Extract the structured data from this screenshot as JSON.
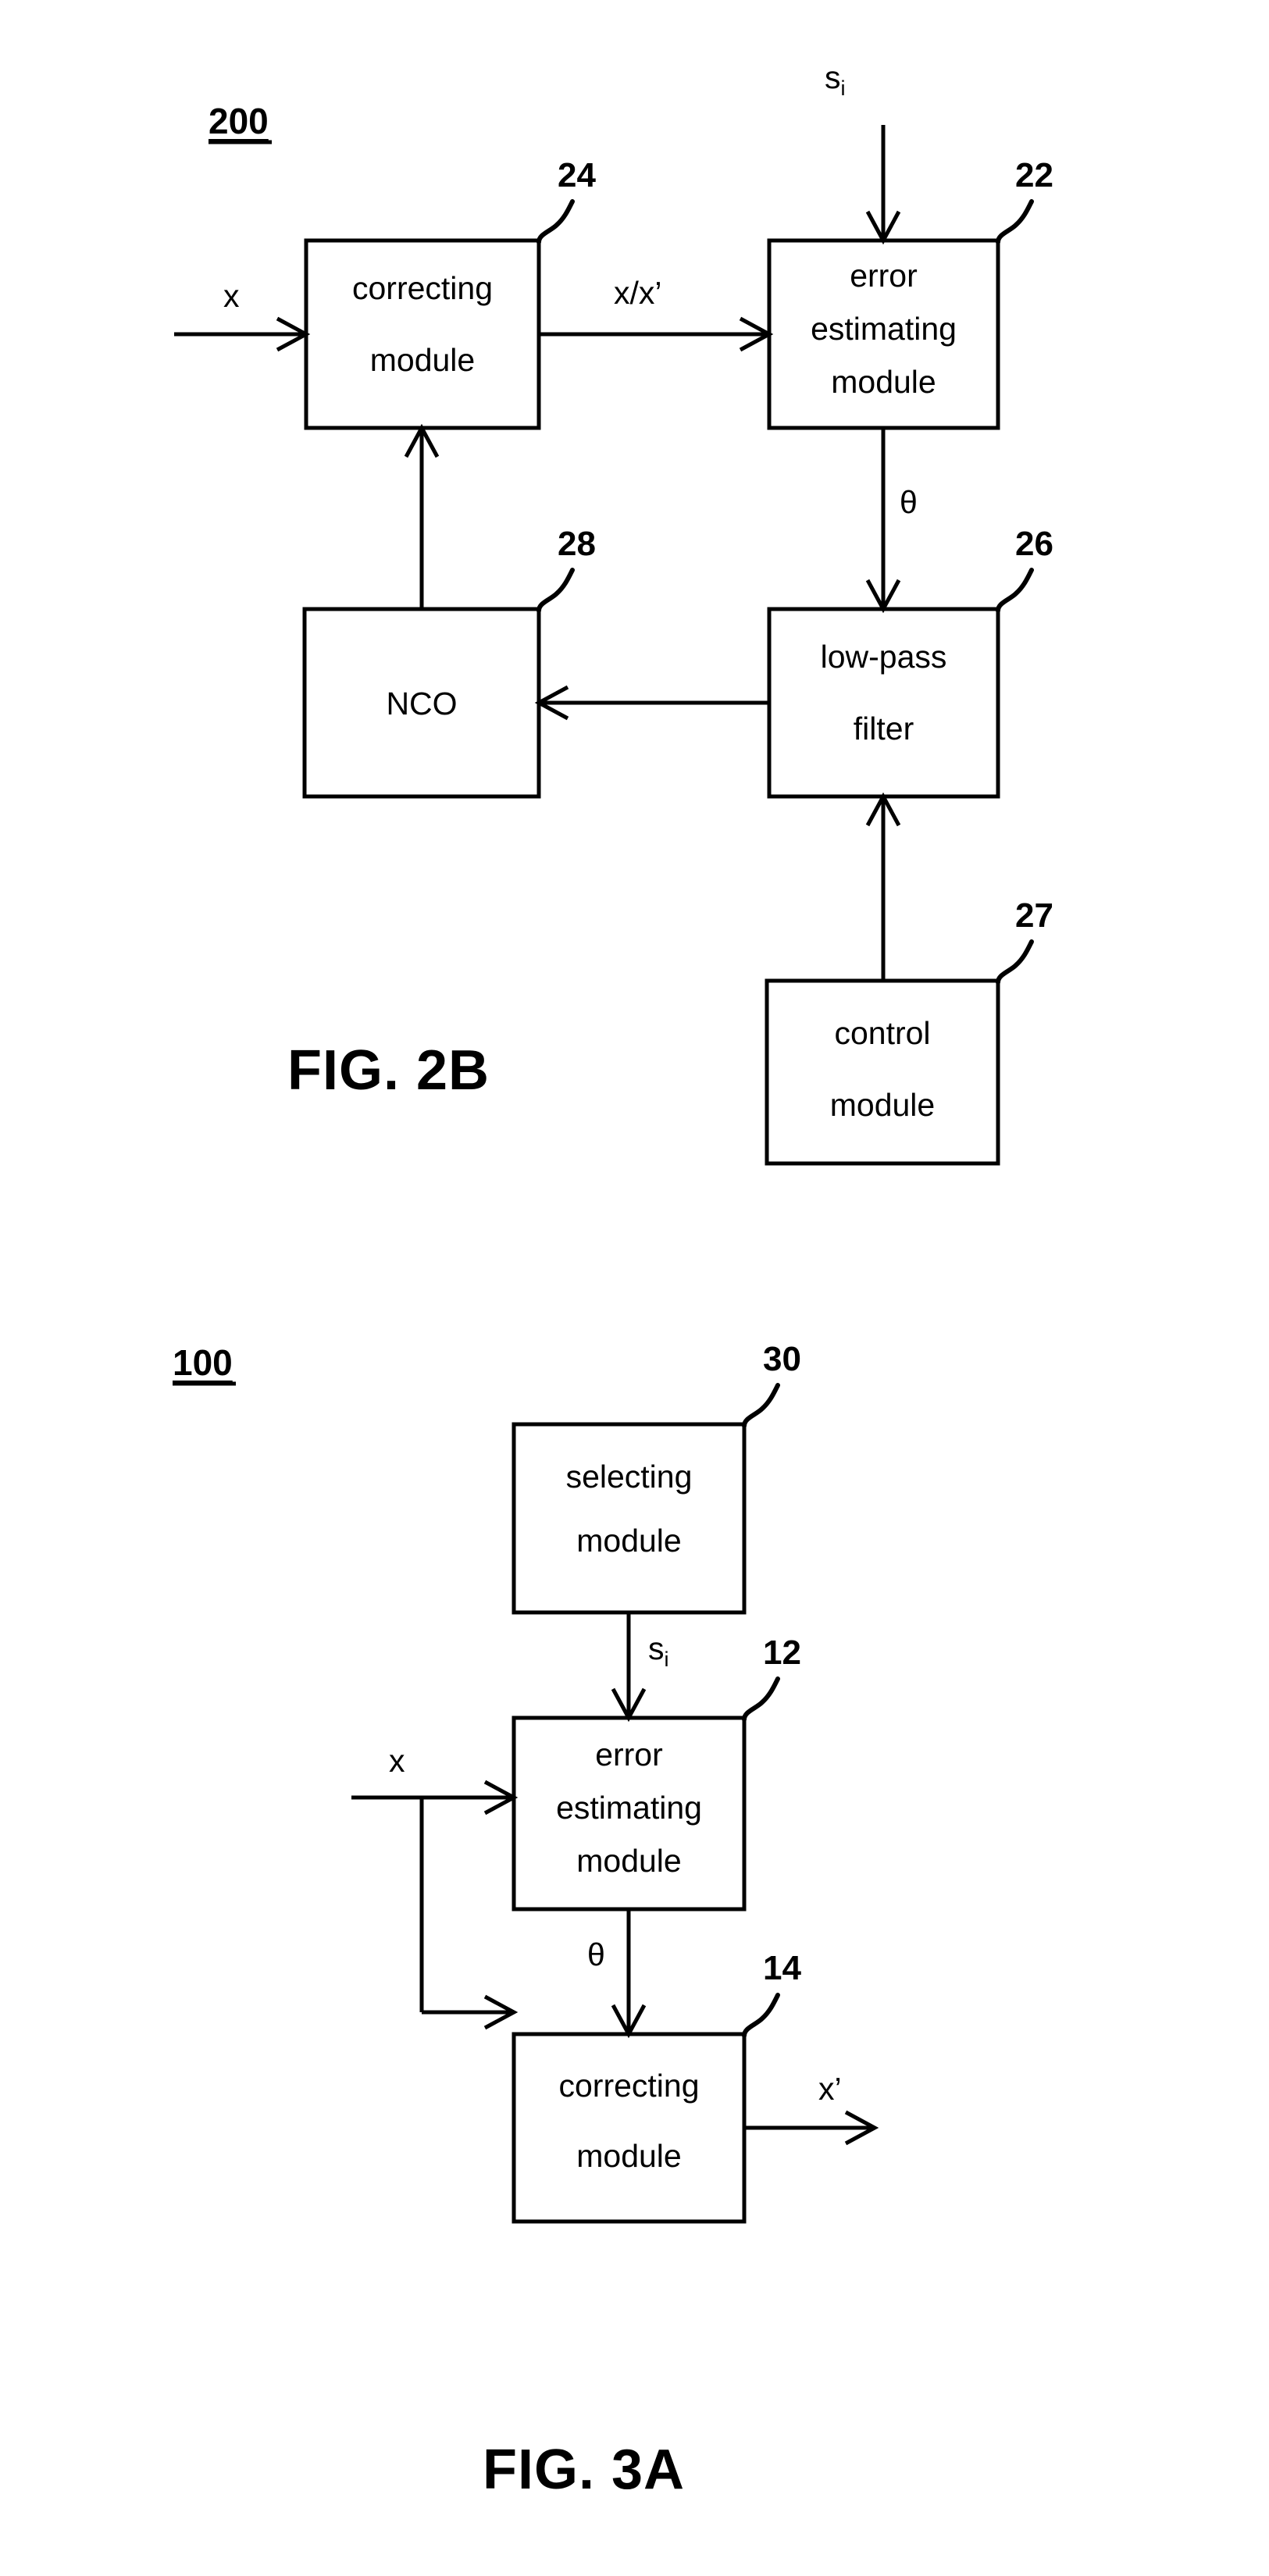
{
  "figures": [
    {
      "id": "fig-2b",
      "caption": "FIG. 2B",
      "system_number": "200",
      "blocks": [
        {
          "key": "correcting_module_24",
          "label_line1": "correcting",
          "label_line2": "module",
          "ref": "24"
        },
        {
          "key": "error_estimating_module_22",
          "label_line1": "error",
          "label_line2": "estimating",
          "label_line3": "module",
          "ref": "22"
        },
        {
          "key": "nco_28",
          "label_line1": "NCO",
          "ref": "28"
        },
        {
          "key": "low_pass_filter_26",
          "label_line1": "low-pass",
          "label_line2": "filter",
          "ref": "26"
        },
        {
          "key": "control_module_27",
          "label_line1": "control",
          "label_line2": "module",
          "ref": "27"
        }
      ],
      "signals": {
        "input_x": "x",
        "si_base": "s",
        "si_sub": "i",
        "x_over_xprime": "x/x’",
        "theta": "θ"
      }
    },
    {
      "id": "fig-3a",
      "caption": "FIG. 3A",
      "system_number": "100",
      "blocks": [
        {
          "key": "selecting_module_30",
          "label_line1": "selecting",
          "label_line2": "module",
          "ref": "30"
        },
        {
          "key": "error_estimating_module_12",
          "label_line1": "error",
          "label_line2": "estimating",
          "label_line3": "module",
          "ref": "12"
        },
        {
          "key": "correcting_module_14",
          "label_line1": "correcting",
          "label_line2": "module",
          "ref": "14"
        }
      ],
      "signals": {
        "input_x": "x",
        "si_base": "s",
        "si_sub": "i",
        "theta": "θ",
        "output_xprime": "x’"
      }
    }
  ],
  "colors": {
    "ink": "#000000",
    "paper": "#ffffff"
  }
}
